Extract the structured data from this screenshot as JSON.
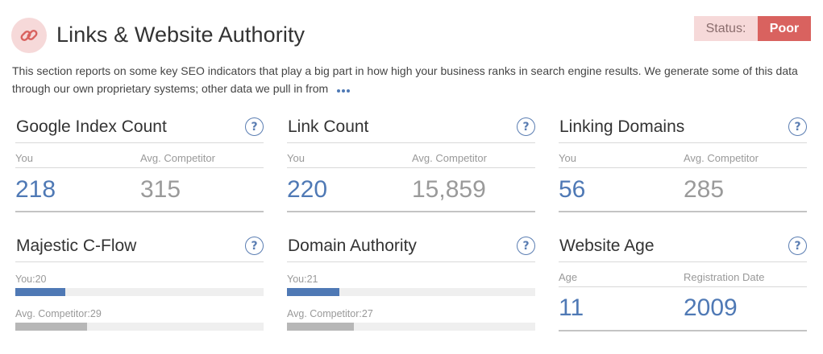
{
  "header": {
    "title": "Links & Website Authority",
    "status_label": "Status:",
    "status_value": "Poor",
    "description": "This section reports on some key SEO indicators that play a big part in how high your business ranks in search engine results. We generate some of this data through our own proprietary systems; other data we pull in from"
  },
  "cards": {
    "google_index": {
      "title": "Google Index Count",
      "you_label": "You",
      "avg_label": "Avg. Competitor",
      "you_value": "218",
      "avg_value": "315"
    },
    "link_count": {
      "title": "Link Count",
      "you_label": "You",
      "avg_label": "Avg. Competitor",
      "you_value": "220",
      "avg_value": "15,859"
    },
    "linking_domains": {
      "title": "Linking Domains",
      "you_label": "You",
      "avg_label": "Avg. Competitor",
      "you_value": "56",
      "avg_value": "285"
    },
    "majestic": {
      "title": "Majestic C-Flow",
      "you_label": "You:20",
      "avg_label": "Avg. Competitor:29",
      "you_value": 20,
      "avg_value": 29,
      "scale_max": 100
    },
    "domain_authority": {
      "title": "Domain Authority",
      "you_label": "You:21",
      "avg_label": "Avg. Competitor:27",
      "you_value": 21,
      "avg_value": 27,
      "scale_max": 100
    },
    "website_age": {
      "title": "Website Age",
      "age_label": "Age",
      "reg_label": "Registration Date",
      "age_value": "11",
      "reg_value": "2009"
    }
  },
  "colors": {
    "accent_blue": "#4f79b5",
    "status_poor": "#d9625f",
    "status_bg": "#f6d9d9",
    "bar_avg": "#b7b7b7"
  },
  "icons": {
    "header_icon": "link-icon",
    "help_icon": "question-icon",
    "more_icon": "more-dots-icon"
  }
}
